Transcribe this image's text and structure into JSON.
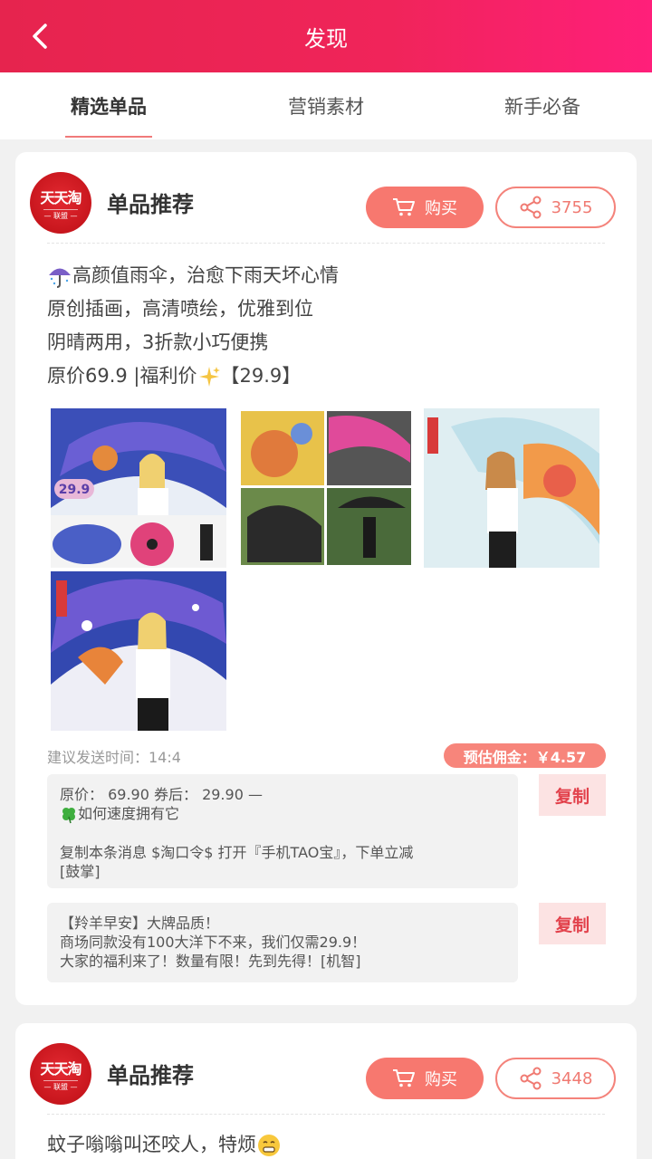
{
  "header": {
    "title": "发现",
    "back_icon": "chevron-left-icon"
  },
  "tabs": [
    {
      "label": "精选单品",
      "active": true
    },
    {
      "label": "营销素材",
      "active": false
    },
    {
      "label": "新手必备",
      "active": false
    }
  ],
  "posts": [
    {
      "logo": {
        "brand": "天天淘",
        "sub": "— 联盟 —"
      },
      "title": "单品推荐",
      "buy_label": "购买",
      "share_count": "3755",
      "desc_lines": [
        "高颜值雨伞，治愈下雨天坏心情",
        "原创插画，高清喷绘，优雅到位",
        "阴晴两用，3折款小巧便携",
        "原价69.9 |福利价",
        "【29.9】"
      ],
      "thumb_badge": "29.9",
      "suggest_time": "建议发送时间：14:4",
      "commission": "预估佣金：￥4.57",
      "messages": [
        {
          "lines": [
            "原价： 69.90 券后： 29.90 —",
            "如何速度拥有它",
            "",
            "复制本条消息 $淘口令$ 打开『手机TAO宝』，下单立减",
            "[鼓掌]"
          ]
        },
        {
          "lines": [
            "【羚羊早安】大牌品质！",
            "商场同款没有100大洋下不来，我们仅需29.9！",
            "大家的福利来了！数量有限！先到先得！[机智]"
          ]
        }
      ],
      "copy_label": "复制"
    },
    {
      "logo": {
        "brand": "天天淘",
        "sub": "— 联盟 —"
      },
      "title": "单品推荐",
      "buy_label": "购买",
      "share_count": "3448",
      "desc_lines": [
        "蚊子嗡嗡叫还咬人，特烦"
      ]
    }
  ],
  "colors": {
    "header_start": "#e6244e",
    "header_end": "#ff1f7a",
    "accent": "#f7786f",
    "copy_text": "#e2424c"
  }
}
